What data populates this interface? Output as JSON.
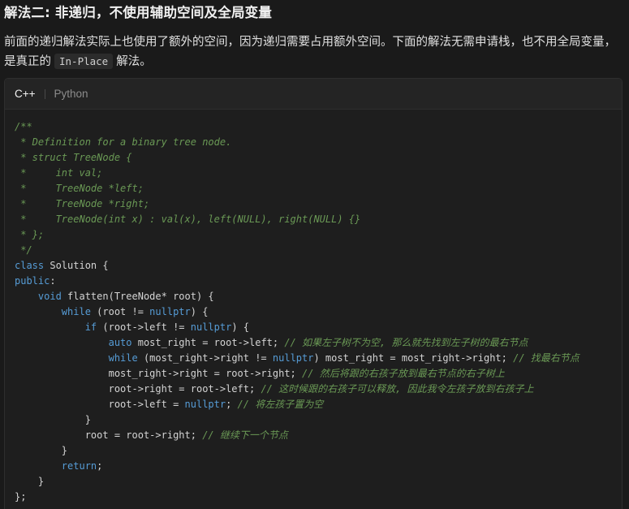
{
  "heading": {
    "title": "解法二: 非递归，不使用辅助空间及全局变量"
  },
  "intro": {
    "part1": "前面的递归解法实际上也使用了额外的空间，因为递归需要占用额外空间。下面的解法无需申请栈，也不用全局变量，是真正的",
    "inline_code": "In-Place",
    "part2": "解法。"
  },
  "tabs": [
    {
      "label": "C++",
      "active": true
    },
    {
      "label": "Python",
      "active": false
    }
  ],
  "colors": {
    "comment": "#6a9955",
    "keyword": "#569cd6",
    "text": "#d4d4d4",
    "background": "#1e1e1e"
  },
  "code_lines": [
    [
      {
        "t": "/**",
        "c": "comment"
      }
    ],
    [
      {
        "t": " * Definition for a binary tree node.",
        "c": "comment"
      }
    ],
    [
      {
        "t": " * struct TreeNode {",
        "c": "comment"
      }
    ],
    [
      {
        "t": " *     int val;",
        "c": "comment"
      }
    ],
    [
      {
        "t": " *     TreeNode *left;",
        "c": "comment"
      }
    ],
    [
      {
        "t": " *     TreeNode *right;",
        "c": "comment"
      }
    ],
    [
      {
        "t": " *     TreeNode(int x) : val(x), left(NULL), right(NULL) {}",
        "c": "comment"
      }
    ],
    [
      {
        "t": " * };",
        "c": "comment"
      }
    ],
    [
      {
        "t": " */",
        "c": "comment"
      }
    ],
    [
      {
        "t": "class",
        "c": "kw"
      },
      {
        "t": " Solution {",
        "c": "plain"
      }
    ],
    [
      {
        "t": "public",
        "c": "kw"
      },
      {
        "t": ":",
        "c": "plain"
      }
    ],
    [
      {
        "t": "    ",
        "c": "plain"
      },
      {
        "t": "void",
        "c": "kw"
      },
      {
        "t": " flatten(TreeNode* root) {",
        "c": "plain"
      }
    ],
    [
      {
        "t": "        ",
        "c": "plain"
      },
      {
        "t": "while",
        "c": "kw"
      },
      {
        "t": " (root != ",
        "c": "plain"
      },
      {
        "t": "nullptr",
        "c": "kw"
      },
      {
        "t": ") {",
        "c": "plain"
      }
    ],
    [
      {
        "t": "            ",
        "c": "plain"
      },
      {
        "t": "if",
        "c": "kw"
      },
      {
        "t": " (root->left != ",
        "c": "plain"
      },
      {
        "t": "nullptr",
        "c": "kw"
      },
      {
        "t": ") {",
        "c": "plain"
      }
    ],
    [
      {
        "t": "                ",
        "c": "plain"
      },
      {
        "t": "auto",
        "c": "kw"
      },
      {
        "t": " most_right = root->left; ",
        "c": "plain"
      },
      {
        "t": "// 如果左子树不为空, 那么就先找到左子树的最右节点",
        "c": "comment"
      }
    ],
    [
      {
        "t": "                ",
        "c": "plain"
      },
      {
        "t": "while",
        "c": "kw"
      },
      {
        "t": " (most_right->right != ",
        "c": "plain"
      },
      {
        "t": "nullptr",
        "c": "kw"
      },
      {
        "t": ") most_right = most_right->right; ",
        "c": "plain"
      },
      {
        "t": "// 找最右节点",
        "c": "comment"
      }
    ],
    [
      {
        "t": "                most_right->right = root->right; ",
        "c": "plain"
      },
      {
        "t": "// 然后将跟的右孩子放到最右节点的右子树上",
        "c": "comment"
      }
    ],
    [
      {
        "t": "                root->right = root->left; ",
        "c": "plain"
      },
      {
        "t": "// 这时候跟的右孩子可以释放, 因此我令左孩子放到右孩子上",
        "c": "comment"
      }
    ],
    [
      {
        "t": "                root->left = ",
        "c": "plain"
      },
      {
        "t": "nullptr",
        "c": "kw"
      },
      {
        "t": "; ",
        "c": "plain"
      },
      {
        "t": "// 将左孩子置为空",
        "c": "comment"
      }
    ],
    [
      {
        "t": "            }",
        "c": "plain"
      }
    ],
    [
      {
        "t": "            root = root->right; ",
        "c": "plain"
      },
      {
        "t": "// 继续下一个节点",
        "c": "comment"
      }
    ],
    [
      {
        "t": "        }",
        "c": "plain"
      }
    ],
    [
      {
        "t": "        ",
        "c": "plain"
      },
      {
        "t": "return",
        "c": "kw"
      },
      {
        "t": ";",
        "c": "plain"
      }
    ],
    [
      {
        "t": "    }",
        "c": "plain"
      }
    ],
    [
      {
        "t": "};",
        "c": "plain"
      }
    ]
  ]
}
